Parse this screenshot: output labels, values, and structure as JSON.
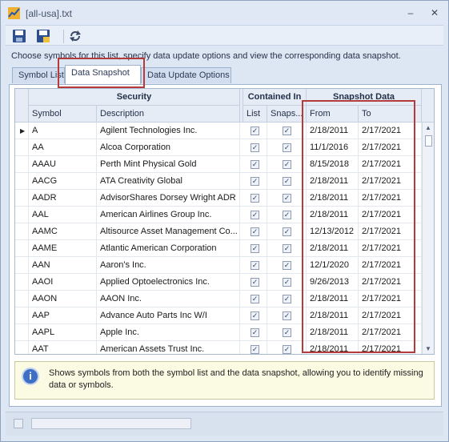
{
  "window": {
    "title": "[all-usa].txt",
    "minimize_glyph": "‒",
    "close_glyph": "✕"
  },
  "toolbar": {
    "save_icon": "save-icon",
    "save_as_icon": "save-as-icon",
    "refresh_icon": "refresh-icon"
  },
  "instruction": "Choose symbols for this list, specify data update options and view the corresponding data snapshot.",
  "tabs": [
    {
      "label": "Symbol List"
    },
    {
      "label": "Data Snapshot"
    },
    {
      "label": "Data Update Options"
    }
  ],
  "grid": {
    "groups": {
      "security": "Security",
      "contained_in": "Contained In",
      "snapshot": "Snapshot Data"
    },
    "columns": {
      "symbol": "Symbol",
      "description": "Description",
      "list": "List",
      "snaps": "Snaps...",
      "from": "From",
      "to": "To"
    },
    "current_row_marker": "▶",
    "rows": [
      {
        "symbol": "A",
        "description": "Agilent Technologies Inc.",
        "list": true,
        "snaps": true,
        "from": "2/18/2011",
        "to": "2/17/2021"
      },
      {
        "symbol": "AA",
        "description": "Alcoa Corporation",
        "list": true,
        "snaps": true,
        "from": "11/1/2016",
        "to": "2/17/2021"
      },
      {
        "symbol": "AAAU",
        "description": "Perth Mint Physical Gold",
        "list": true,
        "snaps": true,
        "from": "8/15/2018",
        "to": "2/17/2021"
      },
      {
        "symbol": "AACG",
        "description": "ATA Creativity Global",
        "list": true,
        "snaps": true,
        "from": "2/18/2011",
        "to": "2/17/2021"
      },
      {
        "symbol": "AADR",
        "description": "AdvisorShares Dorsey Wright ADR",
        "list": true,
        "snaps": true,
        "from": "2/18/2011",
        "to": "2/17/2021"
      },
      {
        "symbol": "AAL",
        "description": "American Airlines Group Inc.",
        "list": true,
        "snaps": true,
        "from": "2/18/2011",
        "to": "2/17/2021"
      },
      {
        "symbol": "AAMC",
        "description": "Altisource Asset Management Co...",
        "list": true,
        "snaps": true,
        "from": "12/13/2012",
        "to": "2/17/2021"
      },
      {
        "symbol": "AAME",
        "description": "Atlantic American Corporation",
        "list": true,
        "snaps": true,
        "from": "2/18/2011",
        "to": "2/17/2021"
      },
      {
        "symbol": "AAN",
        "description": "Aaron's Inc.",
        "list": true,
        "snaps": true,
        "from": "12/1/2020",
        "to": "2/17/2021"
      },
      {
        "symbol": "AAOI",
        "description": "Applied Optoelectronics Inc.",
        "list": true,
        "snaps": true,
        "from": "9/26/2013",
        "to": "2/17/2021"
      },
      {
        "symbol": "AAON",
        "description": "AAON Inc.",
        "list": true,
        "snaps": true,
        "from": "2/18/2011",
        "to": "2/17/2021"
      },
      {
        "symbol": "AAP",
        "description": "Advance Auto Parts Inc W/I",
        "list": true,
        "snaps": true,
        "from": "2/18/2011",
        "to": "2/17/2021"
      },
      {
        "symbol": "AAPL",
        "description": "Apple Inc.",
        "list": true,
        "snaps": true,
        "from": "2/18/2011",
        "to": "2/17/2021"
      },
      {
        "symbol": "AAT",
        "description": "American Assets Trust Inc.",
        "list": true,
        "snaps": true,
        "from": "2/18/2011",
        "to": "2/17/2021"
      }
    ]
  },
  "info": {
    "icon": "info-icon",
    "text": "Shows symbols from both the symbol list and the data snapshot, allowing you to identify missing data or symbols."
  },
  "colors": {
    "highlight": "#b53a3a",
    "info_bg": "#fbfbe3",
    "window_bg": "#dde6f3"
  }
}
